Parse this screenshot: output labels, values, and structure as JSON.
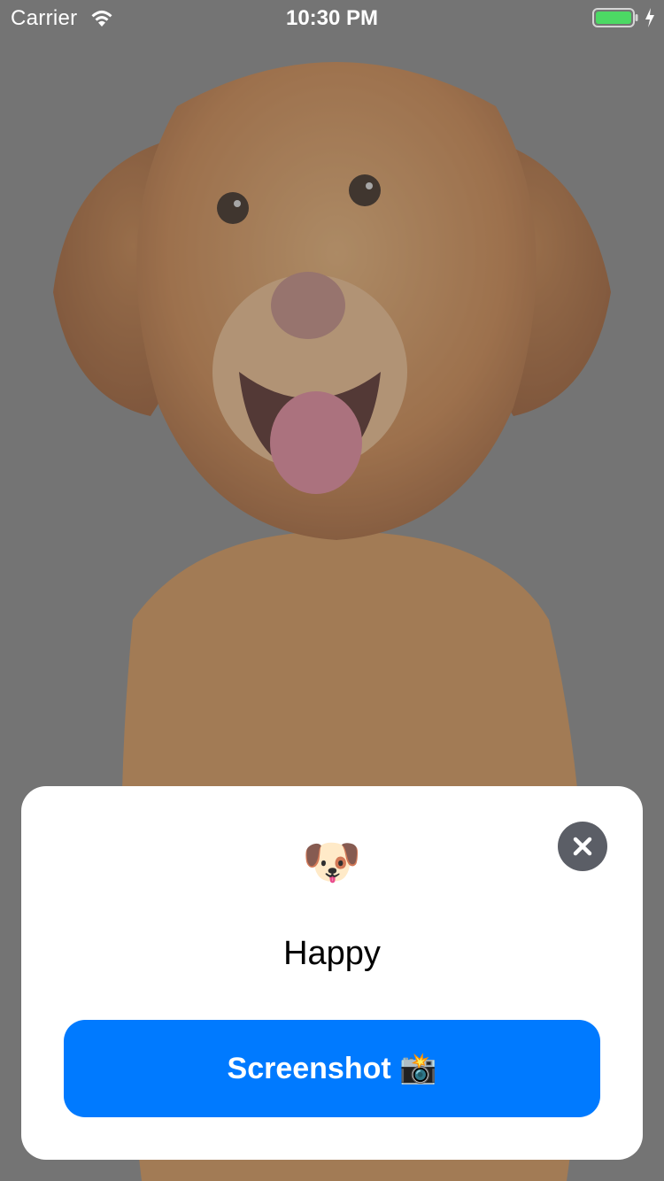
{
  "status_bar": {
    "carrier": "Carrier",
    "time": "10:30 PM",
    "battery_color": "#4cd964"
  },
  "background": {
    "subject": "golden-retriever-puppy-photo"
  },
  "card": {
    "emoji": "🐶",
    "mood": "Happy",
    "close_icon": "close-icon",
    "button": {
      "label": "Screenshot 📸",
      "color": "#007aff"
    }
  }
}
